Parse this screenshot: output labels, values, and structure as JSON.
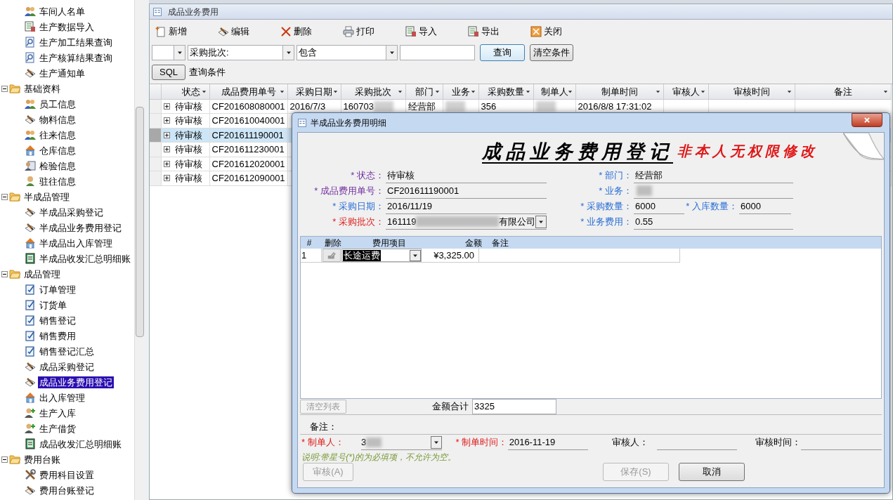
{
  "sidebar": {
    "tree": [
      {
        "children": [
          {
            "label": "车间人名单",
            "kind": "people",
            "selected": false
          },
          {
            "label": "生产数据导入",
            "kind": "sheet",
            "selected": false
          },
          {
            "label": "生产加工结果查询",
            "kind": "magnifier-doc",
            "selected": false
          },
          {
            "label": "生产核算结果查询",
            "kind": "magnifier-doc",
            "selected": false
          },
          {
            "label": "生产通知单",
            "kind": "pen",
            "selected": false
          }
        ]
      },
      {
        "label": "基础资料",
        "kind": "folder",
        "expanded": true,
        "selected": false,
        "children": [
          {
            "label": "员工信息",
            "kind": "people",
            "selected": false
          },
          {
            "label": "物料信息",
            "kind": "pen",
            "selected": false
          },
          {
            "label": "往来信息",
            "kind": "people",
            "selected": false
          },
          {
            "label": "仓库信息",
            "kind": "house",
            "selected": false
          },
          {
            "label": "检验信息",
            "kind": "card",
            "selected": false
          },
          {
            "label": "驻往信息",
            "kind": "person",
            "selected": false
          }
        ]
      },
      {
        "label": "半成品管理",
        "kind": "folder",
        "expanded": true,
        "selected": false,
        "children": [
          {
            "label": "半成品采购登记",
            "kind": "pen",
            "selected": false
          },
          {
            "label": "半成品业务费用登记",
            "kind": "pen",
            "selected": false
          },
          {
            "label": "半成品出入库管理",
            "kind": "house",
            "selected": false
          },
          {
            "label": "半成品收发汇总明细账",
            "kind": "ledger",
            "selected": false
          }
        ]
      },
      {
        "label": "成品管理",
        "kind": "folder",
        "expanded": true,
        "selected": false,
        "children": [
          {
            "label": "订单管理",
            "kind": "check-doc",
            "selected": false
          },
          {
            "label": "订货单",
            "kind": "check-doc",
            "selected": false
          },
          {
            "label": "销售登记",
            "kind": "check-doc",
            "selected": false
          },
          {
            "label": "销售费用",
            "kind": "check-doc",
            "selected": false
          },
          {
            "label": "销售登记汇总",
            "kind": "check-doc",
            "selected": false
          },
          {
            "label": "成品采购登记",
            "kind": "pen",
            "selected": false
          },
          {
            "label": "成品业务费用登记",
            "kind": "pen",
            "selected": true
          },
          {
            "label": "出入库管理",
            "kind": "house",
            "selected": false
          },
          {
            "label": "生产入库",
            "kind": "person-plus",
            "selected": false
          },
          {
            "label": "生产借货",
            "kind": "person-plus",
            "selected": false
          },
          {
            "label": "成品收发汇总明细账",
            "kind": "ledger",
            "selected": false
          }
        ]
      },
      {
        "label": "费用台账",
        "kind": "folder",
        "expanded": true,
        "selected": false,
        "children": [
          {
            "label": "费用科目设置",
            "kind": "tools",
            "selected": false
          },
          {
            "label": "费用台账登记",
            "kind": "pen",
            "selected": false
          }
        ]
      }
    ]
  },
  "window": {
    "title": "成品业务费用"
  },
  "toolbar": [
    {
      "label": "新增",
      "kind": "new"
    },
    {
      "label": "编辑",
      "kind": "pen"
    },
    {
      "label": "删除",
      "kind": "cross"
    },
    {
      "label": "打印",
      "kind": "printer"
    },
    {
      "label": "导入",
      "kind": "sheet"
    },
    {
      "label": "导出",
      "kind": "sheet"
    },
    {
      "label": "关闭",
      "kind": "close"
    }
  ],
  "filter": {
    "field": "采购批次:",
    "operator": "包含",
    "query_button": "查询",
    "clear_button": "清空条件",
    "sql_button": "SQL",
    "condition": "查询条件"
  },
  "table": {
    "columns": [
      "状态",
      "成品费用单号",
      "采购日期",
      "采购批次",
      "部门",
      "业务",
      "采购数量",
      "制单人",
      "制单时间",
      "审核人",
      "审核时间",
      "备注"
    ],
    "rows": [
      {
        "selected": false,
        "cells": [
          "待审核",
          "CF201608080001",
          "2016/7/3",
          {
            "text": "160703",
            "redacted": true
          },
          "经营部",
          {
            "redacted": true
          },
          "356",
          {
            "redacted": true
          },
          "2016/8/8 17:31:02"
        ]
      },
      {
        "selected": false,
        "cells": [
          "待审核",
          "CF201610040001"
        ]
      },
      {
        "selected": true,
        "cells": [
          "待审核",
          "CF201611190001"
        ]
      },
      {
        "selected": false,
        "cells": [
          "待审核",
          "CF201611230001"
        ]
      },
      {
        "selected": false,
        "cells": [
          "待审核",
          "CF201612020001"
        ]
      },
      {
        "selected": false,
        "cells": [
          "待审核",
          "CF201612090001"
        ]
      }
    ]
  },
  "dialog": {
    "title": "半成品业务费用明细",
    "heading": "成品业务费用登记",
    "warning": "非本人无权限修改",
    "left_fields": [
      {
        "label": "* 状态：",
        "value": "待审核",
        "color": "#7030a0"
      },
      {
        "label": "* 成品费用单号：",
        "value": "CF201611190001",
        "color": "#7030a0"
      },
      {
        "label": "* 采购日期：",
        "value": "2016/11/19",
        "color": "#2a6fd6"
      },
      {
        "label": "* 采购批次：",
        "value": "161119",
        "value_end": "有限公司",
        "color": "#e02020",
        "kind": "dropdown"
      }
    ],
    "right_fields": [
      [
        {
          "label": "* 部门：",
          "value": "经营部",
          "color": "#2a6fd6"
        }
      ],
      [
        {
          "label": "* 业务：",
          "color": "#2a6fd6",
          "redacted": true
        }
      ],
      [
        {
          "label": "* 采购数量：",
          "value": "6000",
          "color": "#2a6fd6"
        },
        {
          "label": "* 入库数量：",
          "value": "6000",
          "color": "#2a6fd6"
        }
      ],
      [
        {
          "label": "* 业务费用：",
          "value": "0.55",
          "color": "#2a6fd6"
        }
      ]
    ],
    "lines": {
      "columns": [
        "#",
        "删除",
        "费用项目",
        "金额",
        "备注"
      ],
      "rows": [
        {
          "number": "1",
          "item": "长途运费",
          "amount": "¥3,325.00"
        }
      ]
    },
    "clear_button": {
      "label": "清空列表",
      "disabled": true
    },
    "total_label": "金额合计",
    "total": "3325",
    "note_label": "备注：",
    "maker_label": "* 制单人：",
    "maker": "3",
    "time_label": "* 制单时间：",
    "time": "2016-11-19",
    "reviewer_label": "审核人：",
    "review_time_label": "审核时间：",
    "hint": "说明:带星号(*)的为必填项，不允许为空。",
    "buttons": [
      {
        "label": "审核(A)",
        "disabled": true
      },
      {
        "label": "保存(S)",
        "disabled": true
      },
      {
        "label": "取消",
        "disabled": false
      }
    ]
  }
}
